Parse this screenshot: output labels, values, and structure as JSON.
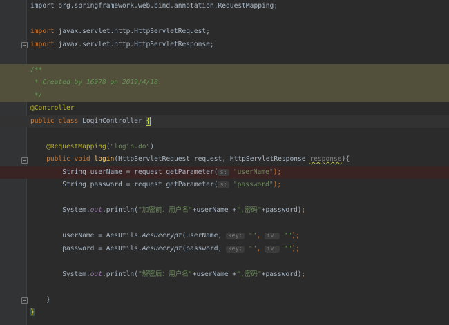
{
  "editor": {
    "lines": [
      {
        "segs": [
          {
            "t": "import org.springframework.web.bind.annotation.RequestMapping;",
            "c": ""
          }
        ]
      },
      {
        "segs": []
      },
      {
        "segs": [
          {
            "t": "import",
            "c": "kw"
          },
          {
            "t": " javax.servlet.http.HttpServletRequest;",
            "c": ""
          }
        ]
      },
      {
        "segs": [
          {
            "t": "import",
            "c": "kw"
          },
          {
            "t": " javax.servlet.http.HttpServletResponse;",
            "c": ""
          }
        ]
      },
      {
        "segs": []
      },
      {
        "segs": [
          {
            "t": "/**",
            "c": "doc"
          }
        ]
      },
      {
        "segs": [
          {
            "t": " * Created by 16978 on 2019/4/18.",
            "c": "doc"
          }
        ]
      },
      {
        "segs": [
          {
            "t": " */",
            "c": "doc"
          }
        ]
      },
      {
        "segs": [
          {
            "t": "@Controller",
            "c": "ann"
          }
        ]
      },
      {
        "segs": [
          {
            "t": "public class",
            "c": "kw"
          },
          {
            "t": " LoginController ",
            "c": ""
          },
          {
            "t": "{",
            "c": "brace-hl"
          }
        ]
      },
      {
        "segs": []
      },
      {
        "segs": [
          {
            "t": "    @RequestMapping",
            "c": "ann"
          },
          {
            "t": "(",
            "c": ""
          },
          {
            "t": "\"login.do\"",
            "c": "str"
          },
          {
            "t": ")",
            "c": ""
          }
        ]
      },
      {
        "segs": [
          {
            "t": "    public void ",
            "c": "kw"
          },
          {
            "t": "login",
            "c": "fn"
          },
          {
            "t": "(HttpServletRequest request, HttpServletResponse ",
            "c": ""
          },
          {
            "t": "response",
            "c": "warn"
          },
          {
            "t": "){",
            "c": ""
          }
        ]
      },
      {
        "segs": [
          {
            "t": "        String userName = request.getParameter(",
            "c": ""
          },
          {
            "t": "s:",
            "c": "hint"
          },
          {
            "t": " ",
            "c": ""
          },
          {
            "t": "\"userName\"",
            "c": "str"
          },
          {
            "t": ");",
            "c": "kw"
          }
        ]
      },
      {
        "segs": [
          {
            "t": "        String password = request.getParameter(",
            "c": ""
          },
          {
            "t": "s:",
            "c": "hint"
          },
          {
            "t": " ",
            "c": ""
          },
          {
            "t": "\"password\"",
            "c": "str"
          },
          {
            "t": ");",
            "c": "kw"
          }
        ]
      },
      {
        "segs": []
      },
      {
        "segs": [
          {
            "t": "        System.",
            "c": ""
          },
          {
            "t": "out",
            "c": "fld"
          },
          {
            "t": ".println(",
            "c": ""
          },
          {
            "t": "\"加密前：用户名\"",
            "c": "str"
          },
          {
            "t": "+userName +",
            "c": ""
          },
          {
            "t": "\",密码\"",
            "c": "str"
          },
          {
            "t": "+password)",
            "c": ""
          },
          {
            "t": ";",
            "c": "kw"
          }
        ]
      },
      {
        "segs": []
      },
      {
        "segs": [
          {
            "t": "        userName = AesUtils.",
            "c": ""
          },
          {
            "t": "AesDecrypt",
            "c": "it"
          },
          {
            "t": "(userName, ",
            "c": ""
          },
          {
            "t": "key:",
            "c": "hint"
          },
          {
            "t": " ",
            "c": ""
          },
          {
            "t": "\"\"",
            "c": "str"
          },
          {
            "t": ", ",
            "c": "kw"
          },
          {
            "t": "iv:",
            "c": "hint"
          },
          {
            "t": " ",
            "c": ""
          },
          {
            "t": "\"\"",
            "c": "str"
          },
          {
            "t": ");",
            "c": "kw"
          }
        ]
      },
      {
        "segs": [
          {
            "t": "        password = AesUtils.",
            "c": ""
          },
          {
            "t": "AesDecrypt",
            "c": "it"
          },
          {
            "t": "(password, ",
            "c": ""
          },
          {
            "t": "key:",
            "c": "hint"
          },
          {
            "t": " ",
            "c": ""
          },
          {
            "t": "\"\"",
            "c": "str"
          },
          {
            "t": ", ",
            "c": "kw"
          },
          {
            "t": "iv:",
            "c": "hint"
          },
          {
            "t": " ",
            "c": ""
          },
          {
            "t": "\"\"",
            "c": "str"
          },
          {
            "t": ");",
            "c": "kw"
          }
        ]
      },
      {
        "segs": []
      },
      {
        "segs": [
          {
            "t": "        System.",
            "c": ""
          },
          {
            "t": "out",
            "c": "fld"
          },
          {
            "t": ".println(",
            "c": ""
          },
          {
            "t": "\"解密后：用户名\"",
            "c": "str"
          },
          {
            "t": "+userName +",
            "c": ""
          },
          {
            "t": "\",密码\"",
            "c": "str"
          },
          {
            "t": "+password)",
            "c": ""
          },
          {
            "t": ";",
            "c": "kw"
          }
        ]
      },
      {
        "segs": []
      },
      {
        "segs": [
          {
            "t": "    }",
            "c": ""
          }
        ]
      },
      {
        "segs": [
          {
            "t": "}",
            "c": "brace-yel"
          }
        ]
      },
      {
        "segs": []
      }
    ]
  },
  "gutter": {
    "breakpoint_line": 13,
    "bean_icon_line": 9,
    "fold_lines": [
      3,
      5,
      7,
      12,
      23
    ]
  },
  "highlights": {
    "doc_lines": [
      5,
      6,
      7
    ],
    "caret_line": 9,
    "breakpoint_line": 13
  },
  "colors": {
    "background": "#2b2b2b",
    "gutter": "#313335",
    "keyword": "#cc7832",
    "string": "#6a8759",
    "annotation": "#bbb529",
    "breakpoint": "#c75450"
  }
}
